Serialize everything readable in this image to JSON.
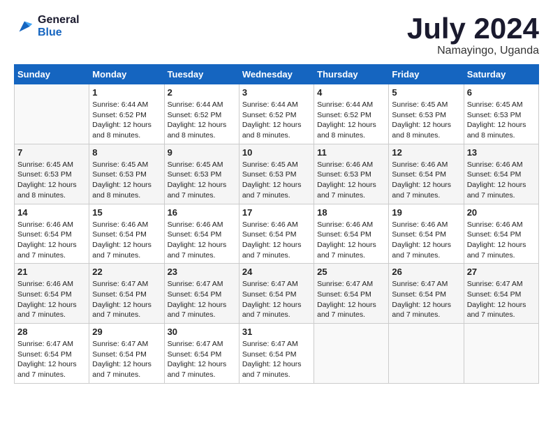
{
  "logo": {
    "line1": "General",
    "line2": "Blue"
  },
  "title": "July 2024",
  "subtitle": "Namayingo, Uganda",
  "weekdays": [
    "Sunday",
    "Monday",
    "Tuesday",
    "Wednesday",
    "Thursday",
    "Friday",
    "Saturday"
  ],
  "weeks": [
    [
      {
        "day": "",
        "info": ""
      },
      {
        "day": "1",
        "info": "Sunrise: 6:44 AM\nSunset: 6:52 PM\nDaylight: 12 hours\nand 8 minutes."
      },
      {
        "day": "2",
        "info": "Sunrise: 6:44 AM\nSunset: 6:52 PM\nDaylight: 12 hours\nand 8 minutes."
      },
      {
        "day": "3",
        "info": "Sunrise: 6:44 AM\nSunset: 6:52 PM\nDaylight: 12 hours\nand 8 minutes."
      },
      {
        "day": "4",
        "info": "Sunrise: 6:44 AM\nSunset: 6:52 PM\nDaylight: 12 hours\nand 8 minutes."
      },
      {
        "day": "5",
        "info": "Sunrise: 6:45 AM\nSunset: 6:53 PM\nDaylight: 12 hours\nand 8 minutes."
      },
      {
        "day": "6",
        "info": "Sunrise: 6:45 AM\nSunset: 6:53 PM\nDaylight: 12 hours\nand 8 minutes."
      }
    ],
    [
      {
        "day": "7",
        "info": "Sunrise: 6:45 AM\nSunset: 6:53 PM\nDaylight: 12 hours\nand 8 minutes."
      },
      {
        "day": "8",
        "info": "Sunrise: 6:45 AM\nSunset: 6:53 PM\nDaylight: 12 hours\nand 8 minutes."
      },
      {
        "day": "9",
        "info": "Sunrise: 6:45 AM\nSunset: 6:53 PM\nDaylight: 12 hours\nand 7 minutes."
      },
      {
        "day": "10",
        "info": "Sunrise: 6:45 AM\nSunset: 6:53 PM\nDaylight: 12 hours\nand 7 minutes."
      },
      {
        "day": "11",
        "info": "Sunrise: 6:46 AM\nSunset: 6:53 PM\nDaylight: 12 hours\nand 7 minutes."
      },
      {
        "day": "12",
        "info": "Sunrise: 6:46 AM\nSunset: 6:54 PM\nDaylight: 12 hours\nand 7 minutes."
      },
      {
        "day": "13",
        "info": "Sunrise: 6:46 AM\nSunset: 6:54 PM\nDaylight: 12 hours\nand 7 minutes."
      }
    ],
    [
      {
        "day": "14",
        "info": "Sunrise: 6:46 AM\nSunset: 6:54 PM\nDaylight: 12 hours\nand 7 minutes."
      },
      {
        "day": "15",
        "info": "Sunrise: 6:46 AM\nSunset: 6:54 PM\nDaylight: 12 hours\nand 7 minutes."
      },
      {
        "day": "16",
        "info": "Sunrise: 6:46 AM\nSunset: 6:54 PM\nDaylight: 12 hours\nand 7 minutes."
      },
      {
        "day": "17",
        "info": "Sunrise: 6:46 AM\nSunset: 6:54 PM\nDaylight: 12 hours\nand 7 minutes."
      },
      {
        "day": "18",
        "info": "Sunrise: 6:46 AM\nSunset: 6:54 PM\nDaylight: 12 hours\nand 7 minutes."
      },
      {
        "day": "19",
        "info": "Sunrise: 6:46 AM\nSunset: 6:54 PM\nDaylight: 12 hours\nand 7 minutes."
      },
      {
        "day": "20",
        "info": "Sunrise: 6:46 AM\nSunset: 6:54 PM\nDaylight: 12 hours\nand 7 minutes."
      }
    ],
    [
      {
        "day": "21",
        "info": "Sunrise: 6:46 AM\nSunset: 6:54 PM\nDaylight: 12 hours\nand 7 minutes."
      },
      {
        "day": "22",
        "info": "Sunrise: 6:47 AM\nSunset: 6:54 PM\nDaylight: 12 hours\nand 7 minutes."
      },
      {
        "day": "23",
        "info": "Sunrise: 6:47 AM\nSunset: 6:54 PM\nDaylight: 12 hours\nand 7 minutes."
      },
      {
        "day": "24",
        "info": "Sunrise: 6:47 AM\nSunset: 6:54 PM\nDaylight: 12 hours\nand 7 minutes."
      },
      {
        "day": "25",
        "info": "Sunrise: 6:47 AM\nSunset: 6:54 PM\nDaylight: 12 hours\nand 7 minutes."
      },
      {
        "day": "26",
        "info": "Sunrise: 6:47 AM\nSunset: 6:54 PM\nDaylight: 12 hours\nand 7 minutes."
      },
      {
        "day": "27",
        "info": "Sunrise: 6:47 AM\nSunset: 6:54 PM\nDaylight: 12 hours\nand 7 minutes."
      }
    ],
    [
      {
        "day": "28",
        "info": "Sunrise: 6:47 AM\nSunset: 6:54 PM\nDaylight: 12 hours\nand 7 minutes."
      },
      {
        "day": "29",
        "info": "Sunrise: 6:47 AM\nSunset: 6:54 PM\nDaylight: 12 hours\nand 7 minutes."
      },
      {
        "day": "30",
        "info": "Sunrise: 6:47 AM\nSunset: 6:54 PM\nDaylight: 12 hours\nand 7 minutes."
      },
      {
        "day": "31",
        "info": "Sunrise: 6:47 AM\nSunset: 6:54 PM\nDaylight: 12 hours\nand 7 minutes."
      },
      {
        "day": "",
        "info": ""
      },
      {
        "day": "",
        "info": ""
      },
      {
        "day": "",
        "info": ""
      }
    ]
  ]
}
